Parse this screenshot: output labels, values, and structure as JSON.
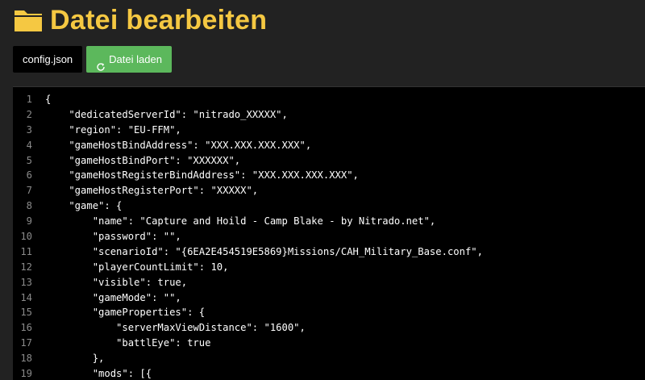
{
  "header": {
    "title": "Datei bearbeiten",
    "icon": "folder-icon",
    "title_color": "#f5c842"
  },
  "toolbar": {
    "file_label": "config.json",
    "load_label": "Datei laden",
    "load_icon": "refresh-icon",
    "load_color": "#5cb85c"
  },
  "editor": {
    "lines": [
      {
        "number": "1",
        "code": "{"
      },
      {
        "number": "2",
        "code": "    \"dedicatedServerId\": \"nitrado_XXXXX\","
      },
      {
        "number": "3",
        "code": "    \"region\": \"EU-FFM\","
      },
      {
        "number": "4",
        "code": "    \"gameHostBindAddress\": \"XXX.XXX.XXX.XXX\","
      },
      {
        "number": "5",
        "code": "    \"gameHostBindPort\": \"XXXXXX\","
      },
      {
        "number": "6",
        "code": "    \"gameHostRegisterBindAddress\": \"XXX.XXX.XXX.XXX\","
      },
      {
        "number": "7",
        "code": "    \"gameHostRegisterPort\": \"XXXXX\","
      },
      {
        "number": "8",
        "code": "    \"game\": {"
      },
      {
        "number": "9",
        "code": "        \"name\": \"Capture and Hoild - Camp Blake - by Nitrado.net\","
      },
      {
        "number": "10",
        "code": "        \"password\": \"\","
      },
      {
        "number": "11",
        "code": "        \"scenarioId\": \"{6EA2E454519E5869}Missions/CAH_Military_Base.conf\","
      },
      {
        "number": "12",
        "code": "        \"playerCountLimit\": 10,"
      },
      {
        "number": "13",
        "code": "        \"visible\": true,"
      },
      {
        "number": "14",
        "code": "        \"gameMode\": \"\","
      },
      {
        "number": "15",
        "code": "        \"gameProperties\": {"
      },
      {
        "number": "16",
        "code": "            \"serverMaxViewDistance\": \"1600\","
      },
      {
        "number": "17",
        "code": "            \"battlEye\": true"
      },
      {
        "number": "18",
        "code": "        },"
      },
      {
        "number": "19",
        "code": "        \"mods\": [{"
      }
    ]
  }
}
